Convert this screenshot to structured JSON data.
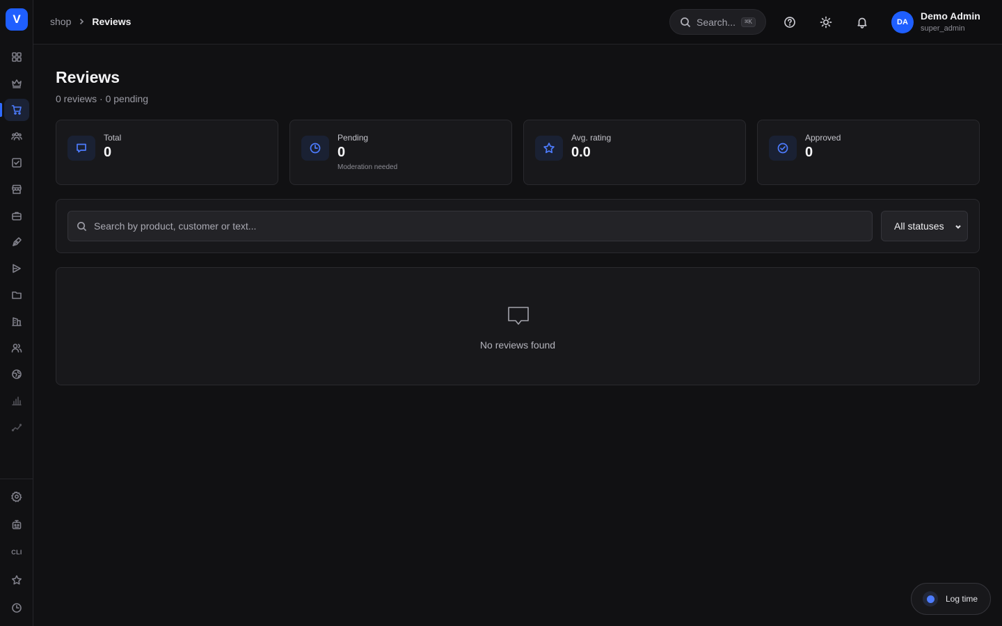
{
  "app": {
    "logo_letter": "V",
    "accent": "#1f5fff"
  },
  "sidebar": {
    "items": [
      {
        "icon": "dashboard-grid-icon"
      },
      {
        "icon": "crown-icon"
      },
      {
        "icon": "shopping-cart-icon",
        "active": true
      },
      {
        "icon": "users-group-icon"
      },
      {
        "icon": "checkbox-icon"
      },
      {
        "icon": "storefront-icon"
      },
      {
        "icon": "briefcase-icon"
      },
      {
        "icon": "pen-tool-icon"
      },
      {
        "icon": "video-icon"
      },
      {
        "icon": "folder-icon"
      },
      {
        "icon": "building-icon"
      },
      {
        "icon": "team-icon"
      },
      {
        "icon": "globe-icon"
      },
      {
        "icon": "bar-chart-icon"
      },
      {
        "icon": "trend-line-icon"
      }
    ],
    "bottom_items": [
      {
        "icon": "settings-gear-icon"
      },
      {
        "icon": "robot-icon"
      },
      {
        "label": "CLI"
      },
      {
        "icon": "star-icon"
      },
      {
        "icon": "clock-icon"
      }
    ]
  },
  "topbar": {
    "breadcrumb": [
      "shop",
      "Reviews"
    ],
    "search_placeholder": "Search...",
    "search_shortcut": "⌘K",
    "user": {
      "initials": "DA",
      "name": "Demo Admin",
      "role": "super_admin"
    }
  },
  "page": {
    "title": "Reviews",
    "subtitle": "0 reviews · 0 pending"
  },
  "stats": [
    {
      "label": "Total",
      "value": "0",
      "note": "",
      "icon": "message-square-icon"
    },
    {
      "label": "Pending",
      "value": "0",
      "note": "Moderation needed",
      "icon": "clock-icon"
    },
    {
      "label": "Avg. rating",
      "value": "0.0",
      "note": "",
      "icon": "star-icon"
    },
    {
      "label": "Approved",
      "value": "0",
      "note": "",
      "icon": "check-circle-icon"
    }
  ],
  "filters": {
    "search_placeholder": "Search by product, customer or text...",
    "status_selected": "All statuses"
  },
  "empty_state": {
    "text": "No reviews found"
  },
  "log_time": {
    "label": "Log time"
  }
}
